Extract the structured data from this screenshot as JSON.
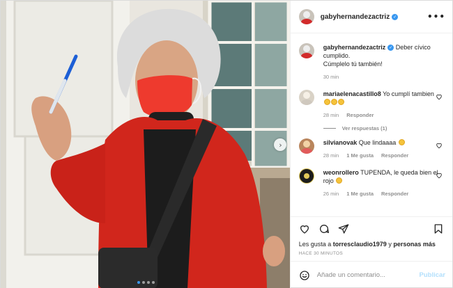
{
  "post": {
    "username": "gabyhernandezactriz",
    "caption_line1": "Deber cívico cumplido.",
    "caption_line2": "Cúmplelo tú también!",
    "caption_time": "30 min",
    "more_icon": "more-horizontal-icon",
    "verified_icon": "verified-badge-icon"
  },
  "comments": [
    {
      "user": "mariaelenacastillo8",
      "text": "Yo cumplí tambien",
      "emoji_count": 3,
      "time": "28 min",
      "reply": "Responder",
      "view_replies": "Ver respuestas (1)"
    },
    {
      "user": "silvianovak",
      "text": "Que lindaaaa",
      "time": "28 min",
      "likes": "1 Me gusta",
      "reply": "Responder"
    },
    {
      "user": "weonrollero",
      "text": "TUPENDA, le queda bien el rojo",
      "time": "26 min",
      "likes": "1 Me gusta",
      "reply": "Responder"
    }
  ],
  "actions": {
    "like_icon": "heart-icon",
    "comment_icon": "comment-icon",
    "share_icon": "share-icon",
    "save_icon": "bookmark-icon"
  },
  "likes": {
    "prefix": "Les gusta a",
    "user": "torresclaudio1979",
    "joiner": "y",
    "others": "personas más"
  },
  "timestamp": "HACE 30 MINUTOS",
  "add_comment": {
    "placeholder": "Añade un comentario...",
    "publish": "Publicar",
    "emoji_icon": "emoji-smile-icon"
  },
  "carousel": {
    "total": 4,
    "active": 1
  },
  "colors": {
    "accent": "#3897f0",
    "text": "#262626",
    "muted": "#8e8e8e",
    "publish_disabled": "#b2dffc"
  }
}
